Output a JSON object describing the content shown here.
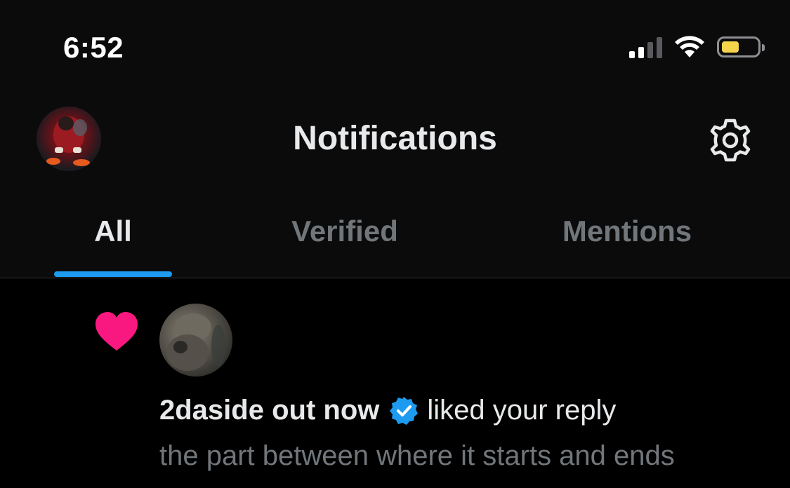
{
  "status_bar": {
    "time": "6:52",
    "icons": [
      "cellular-signal-icon",
      "wifi-icon",
      "battery-icon"
    ],
    "battery_color": "#f5d34b"
  },
  "header": {
    "title": "Notifications",
    "avatar_icon": "profile-avatar",
    "settings_icon": "gear-icon"
  },
  "tabs": [
    {
      "label": "All",
      "active": true
    },
    {
      "label": "Verified",
      "active": false
    },
    {
      "label": "Mentions",
      "active": false
    }
  ],
  "colors": {
    "accent": "#1d9bf0",
    "like": "#f91880",
    "verified": "#1d9bf0"
  },
  "notifications": [
    {
      "type_icon": "heart-icon",
      "actor_name": "2daside out now",
      "verified": true,
      "action": "liked your reply",
      "snippet": "the part between where it starts and ends"
    }
  ]
}
